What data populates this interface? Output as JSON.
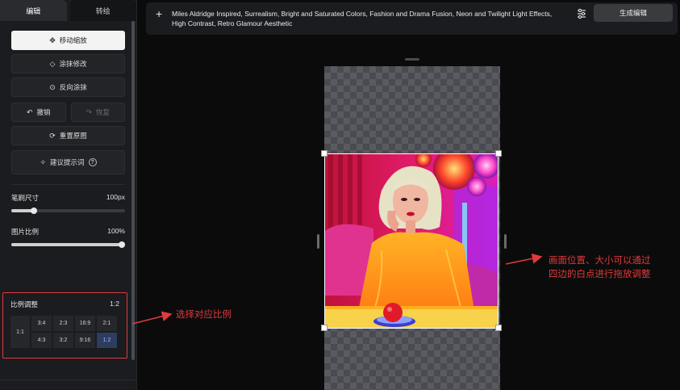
{
  "sidebar": {
    "tabs": [
      "编辑",
      "转绘"
    ],
    "buttons": {
      "move_zoom": "移动缩放",
      "erase_modify": "涂抹修改",
      "reverse_erase": "反向涂抹",
      "undo": "撤销",
      "redo": "恢复",
      "reset_image": "重置原图",
      "suggest_prompt": "建议提示词"
    },
    "brush": {
      "label": "笔刷尺寸",
      "value_text": "100px",
      "fraction": 0.2
    },
    "image_scale": {
      "label": "图片比例",
      "value_text": "100%",
      "fraction": 1.0
    },
    "ratio": {
      "label": "比例调整",
      "current": "1:2",
      "square": "1:1",
      "options": [
        "3:4",
        "2:3",
        "16:9",
        "2:1",
        "4:3",
        "3:2",
        "9:16",
        "1:2"
      ],
      "selected": "1:2"
    }
  },
  "topbar": {
    "add_icon": "plus-icon",
    "prompt": "Miles Aldridge Inspired, Surrealism, Bright and Saturated Colors, Fashion and Drama Fusion, Neon and Twilight Light Effects, High Contrast, Retro Glamour Aesthetic",
    "settings_icon": "sliders-icon",
    "generate_label": "生成编辑"
  },
  "annotations": {
    "ratio_note": "选择对应比例",
    "resize_note_line1": "画面位置、大小可以通过",
    "resize_note_line2": "四边的白点进行拖放调整"
  },
  "colors": {
    "annotation_red": "#e03a3a",
    "selected_ratio_bg": "#2d3d60",
    "primary_button_bg": "#f3f3f3"
  }
}
